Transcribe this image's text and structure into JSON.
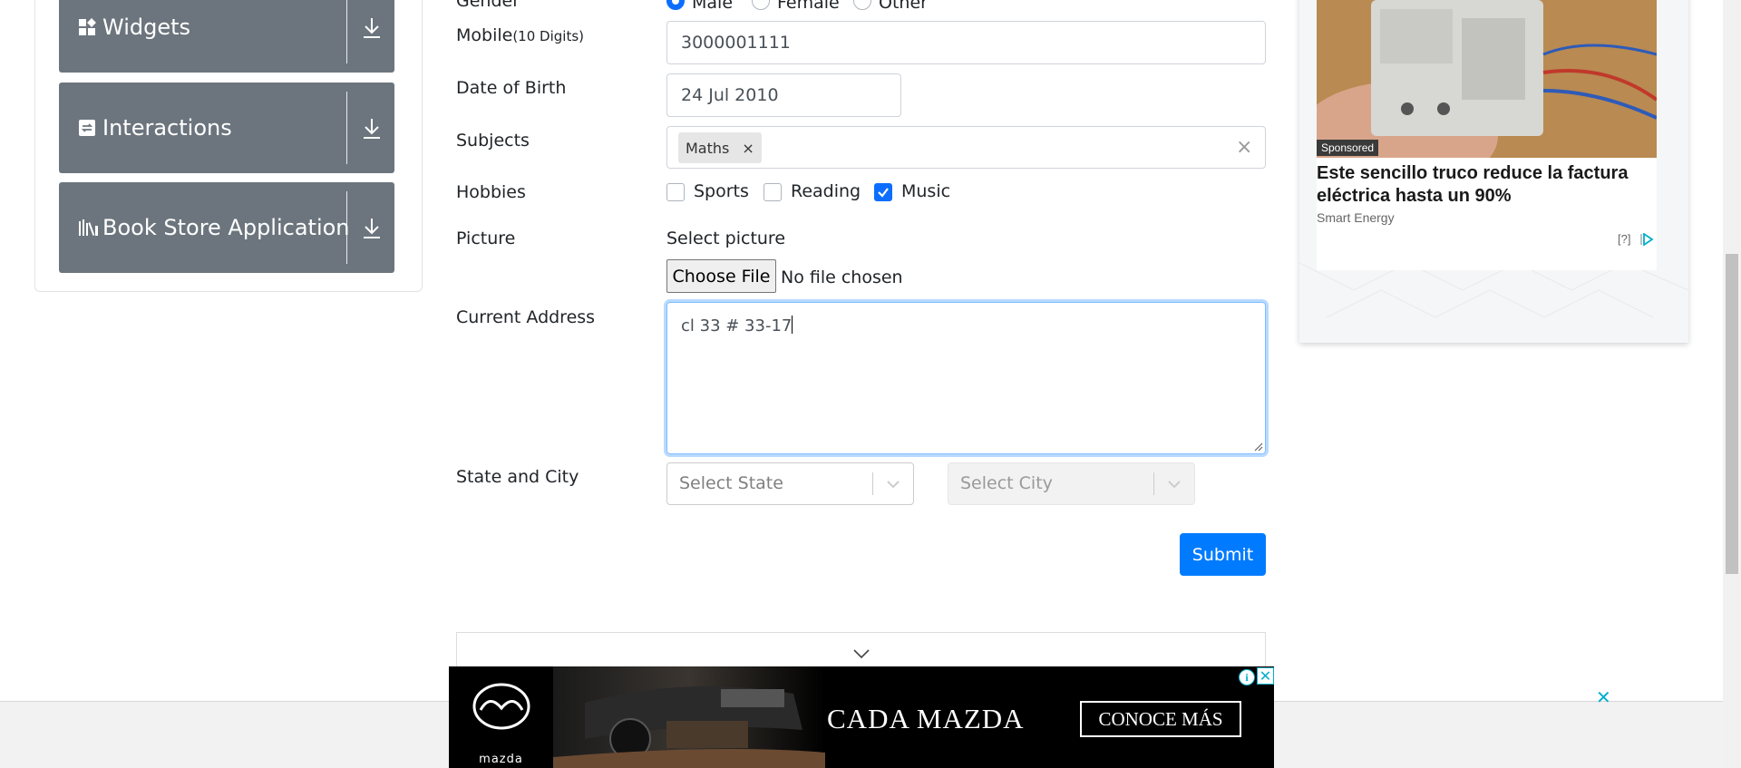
{
  "sidebar": {
    "groups": [
      {
        "label": "Widgets",
        "icon": "widgets-grid-icon"
      },
      {
        "label": "Interactions",
        "icon": "interactions-icon"
      },
      {
        "label": "Book Store Application",
        "icon": "book-store-icon"
      }
    ]
  },
  "form": {
    "gender": {
      "label": "Gender",
      "options": [
        "Male",
        "Female",
        "Other"
      ],
      "selected": "Male"
    },
    "mobile": {
      "label": "Mobile",
      "hint": "(10 Digits)",
      "value": "3000001111"
    },
    "dob": {
      "label": "Date of Birth",
      "value": "24 Jul 2010"
    },
    "subjects": {
      "label": "Subjects",
      "chips": [
        "Maths"
      ],
      "chip_remove": "×",
      "clear": "×"
    },
    "hobbies": {
      "label": "Hobbies",
      "options": [
        {
          "label": "Sports",
          "checked": false
        },
        {
          "label": "Reading",
          "checked": false
        },
        {
          "label": "Music",
          "checked": true
        }
      ]
    },
    "picture": {
      "label": "Picture",
      "select_label": "Select picture",
      "button": "Choose File",
      "status": "No file chosen"
    },
    "address": {
      "label": "Current Address",
      "value": "cl 33 # 33-17"
    },
    "state_city": {
      "label": "State and City",
      "state_placeholder": "Select State",
      "city_placeholder": "Select City"
    },
    "submit": "Submit"
  },
  "right_ad": {
    "badge": "Sponsored",
    "headline": "Este sencillo truco reduce la factura eléctrica hasta un 90%",
    "brand": "Smart Energy",
    "help": "[?]"
  },
  "bottom_ad": {
    "brand": "mazda",
    "headline": "CADA MAZDA",
    "cta": "CONOCE MÁS",
    "info": "i",
    "close": "✕",
    "strip_close": "✕"
  },
  "colors": {
    "primary": "#007bff",
    "sidebar_group": "#6c757d",
    "ad_accent": "#00aecd"
  }
}
